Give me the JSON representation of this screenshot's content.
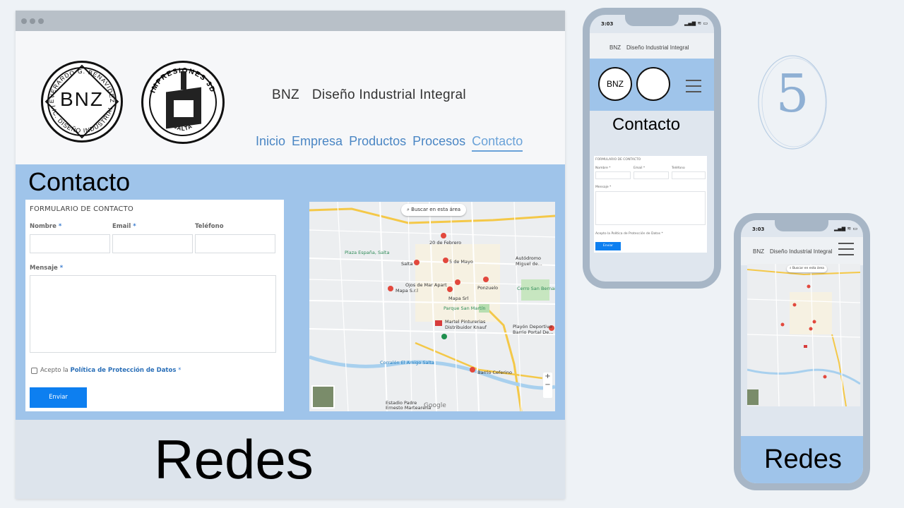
{
  "desktop": {
    "brand": {
      "short": "BNZ",
      "name": "Diseño Industrial Integral"
    },
    "logos": {
      "bnz_text": "BNZ",
      "bnz_ring_top": "EVERARDO G. BENAVIDEZ",
      "bnz_ring_bottom": "LIC. DISEÑO INDUSTRIAL",
      "impresiones_top": "IMPRESIONES 3D",
      "impresiones_bottom": "SALTA"
    },
    "nav": [
      "Inicio",
      "Empresa",
      "Productos",
      "Procesos",
      "Contacto"
    ],
    "active_nav": "Contacto",
    "contact_title": "Contacto",
    "form": {
      "heading": "FORMULARIO DE CONTACTO",
      "name_label": "Nombre",
      "email_label": "Email",
      "phone_label": "Teléfono",
      "message_label": "Mensaje",
      "required_mark": "*",
      "accept_prefix": "Acepto la",
      "accept_link": "Política de Protección de Datos",
      "submit": "Enviar"
    },
    "map": {
      "search": "Buscar en esta área",
      "labels": [
        "20 de Febrero",
        "Plaza España, Salta",
        "Salta",
        "5 de Mayo",
        "Ojos de Mar Apart",
        "Mapa S.r.l",
        "Mapa Srl",
        "Ponzuelo",
        "Parque San Martín",
        "Martel Pinturerias Distribuidor Knauf",
        "Cerro San Bernardo",
        "Playón Deportivo Barrio Portal De...",
        "Corralón El Amigo Salta",
        "Barrio Ceferino",
        "Estadio Padre Ernesto Martearena",
        "Google",
        "Autódromo Miguel de..."
      ],
      "controls": [
        "+",
        "−"
      ]
    },
    "redes_title": "Redes"
  },
  "phone_contact": {
    "time": "3:03",
    "status": "▂▄▆ ≋ ▭",
    "brand_short": "BNZ",
    "brand_name": "Diseño Industrial Integral",
    "logo_text": "BNZ",
    "title": "Contacto",
    "form": {
      "heading": "FORMULARIO DE CONTACTO",
      "name": "Nombre *",
      "email": "Email *",
      "phone": "Teléfono",
      "message": "Mensaje *",
      "accept": "Acepto la Política de Protección de Datos *",
      "submit": "Enviar"
    }
  },
  "phone_map": {
    "time": "3:03",
    "status": "▂▄▆ ≋ ▭",
    "brand_short": "BNZ",
    "brand_name": "Diseño Industrial Integral",
    "search": "Buscar en esta área",
    "redes_title": "Redes"
  },
  "step_number": "5",
  "colors": {
    "accent_blue": "#9fc4ea",
    "nav_blue": "#4a86c4",
    "button_blue": "#0d7ff0",
    "phone_frame": "#a7b6c6"
  }
}
